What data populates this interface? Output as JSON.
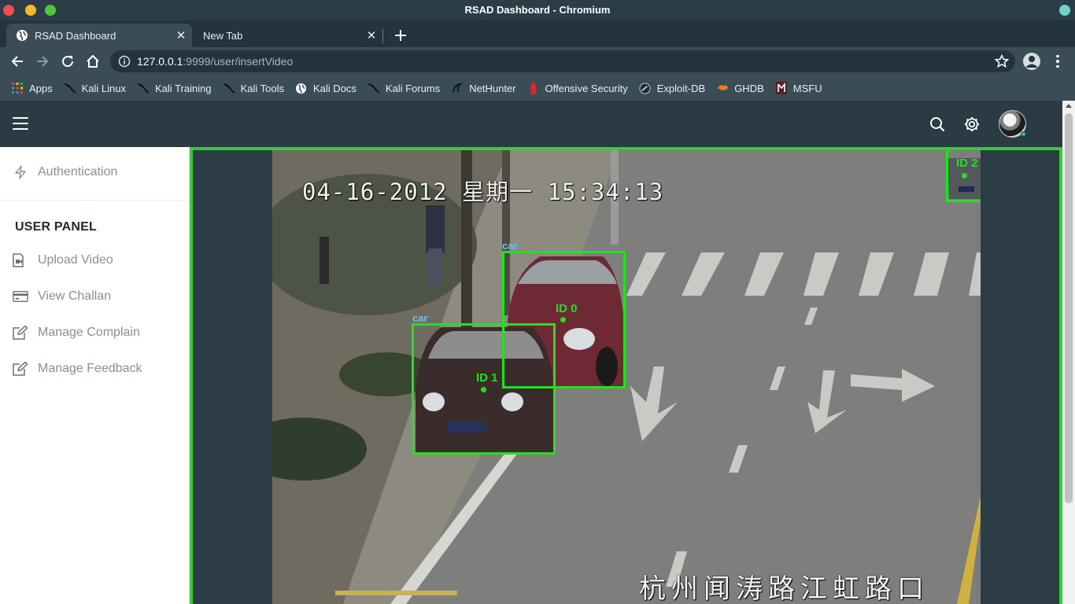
{
  "window": {
    "title": "RSAD Dashboard - Chromium"
  },
  "tabs": [
    {
      "title": "RSAD Dashboard",
      "active": true
    },
    {
      "title": "New Tab",
      "active": false
    }
  ],
  "address_bar": {
    "host": "127.0.0.1",
    "rest": ":9999/user/insertVideo"
  },
  "bookmarks": [
    {
      "label": "Apps",
      "icon": "apps-grid-icon"
    },
    {
      "label": "Kali Linux",
      "icon": "kali-dragon-icon"
    },
    {
      "label": "Kali Training",
      "icon": "kali-dragon-icon"
    },
    {
      "label": "Kali Tools",
      "icon": "kali-dragon-icon"
    },
    {
      "label": "Kali Docs",
      "icon": "globe-icon"
    },
    {
      "label": "Kali Forums",
      "icon": "kali-dragon-icon"
    },
    {
      "label": "NetHunter",
      "icon": "nethunter-icon"
    },
    {
      "label": "Offensive Security",
      "icon": "offsec-icon"
    },
    {
      "label": "Exploit-DB",
      "icon": "exploitdb-icon"
    },
    {
      "label": "GHDB",
      "icon": "ghdb-icon"
    },
    {
      "label": "MSFU",
      "icon": "msfu-icon"
    }
  ],
  "sidebar": {
    "top_item": {
      "label": "Authentication",
      "icon": "bolt-icon"
    },
    "section_heading": "USER PANEL",
    "items": [
      {
        "label": "Upload Video",
        "icon": "video-upload-icon"
      },
      {
        "label": "View Challan",
        "icon": "credit-card-icon"
      },
      {
        "label": "Manage Complain",
        "icon": "edit-icon"
      },
      {
        "label": "Manage Feedback",
        "icon": "edit-icon"
      }
    ]
  },
  "video": {
    "timestamp": "04-16-2012 星期一 15:34:13",
    "location": "杭州闻涛路江虹路口",
    "detections": [
      {
        "class": "car",
        "id": "ID 0"
      },
      {
        "class": "car",
        "id": "ID 1"
      },
      {
        "class": "",
        "id": "ID 2"
      }
    ]
  },
  "colors": {
    "header_bg": "#2a3b44",
    "detection_box": "#22e022",
    "class_label": "#6ec1ef"
  }
}
